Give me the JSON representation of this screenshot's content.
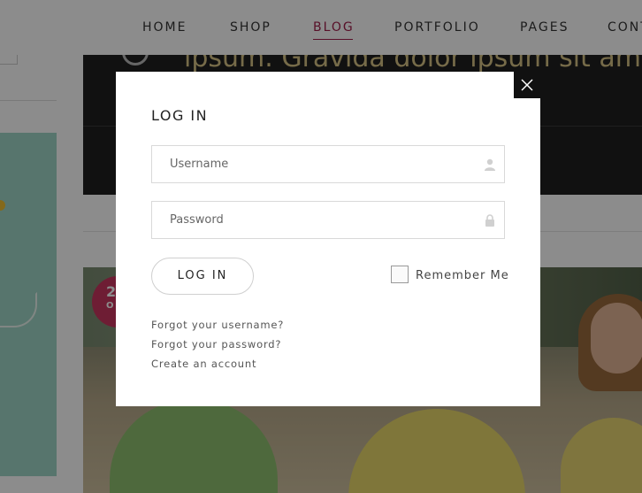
{
  "nav": {
    "items": [
      {
        "label": "HOME",
        "active": false
      },
      {
        "label": "SHOP",
        "active": false
      },
      {
        "label": "BLOG",
        "active": true
      },
      {
        "label": "PORTFOLIO",
        "active": false
      },
      {
        "label": "PAGES",
        "active": false
      },
      {
        "label": "CONT",
        "active": false
      }
    ],
    "active_color": "#a01f4c"
  },
  "background": {
    "banner_text": "ipsum. Gravida dolor ipsum sit am",
    "date_badge": {
      "day": "2",
      "month": "O"
    }
  },
  "login_modal": {
    "title": "LOG IN",
    "close_icon": "close-icon",
    "username_field": {
      "placeholder": "Username",
      "value": "",
      "icon": "user-icon"
    },
    "password_field": {
      "placeholder": "Password",
      "value": "",
      "icon": "lock-icon"
    },
    "submit_label": "LOG IN",
    "remember_me": {
      "label": "Remember Me",
      "checked": false
    },
    "links": [
      "Forgot your username?",
      "Forgot your password?",
      "Create an account"
    ]
  }
}
